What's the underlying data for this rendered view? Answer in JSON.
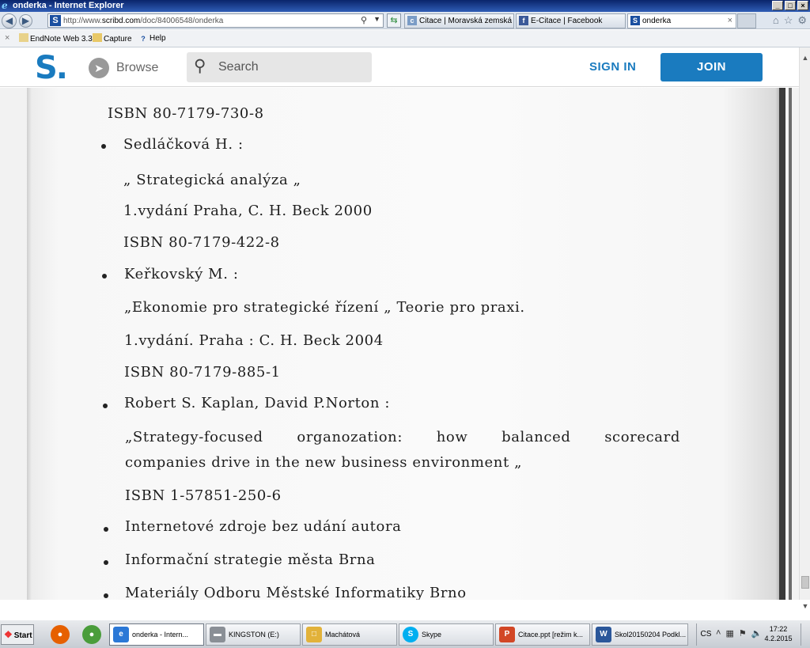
{
  "window": {
    "title": "onderka - Internet Explorer",
    "buttons": [
      "_",
      "□",
      "×"
    ]
  },
  "address": {
    "url_prefix": "http://www.",
    "url_domain": "scribd.com",
    "url_path": "/doc/84006548/onderka"
  },
  "tabs": [
    {
      "label": "Citace | Moravská zemská ...",
      "icon": "citace-icon",
      "color": "#7a9cc6"
    },
    {
      "label": "E-Citace | Facebook",
      "icon": "facebook-icon",
      "color": "#3b5998"
    },
    {
      "label": "onderka",
      "icon": "scribd-icon",
      "color": "#1a4fa0"
    }
  ],
  "favorites": [
    {
      "label": "EndNote Web 3.3"
    },
    {
      "label": "Capture"
    },
    {
      "label": "Help"
    }
  ],
  "scribd": {
    "logo": "S.",
    "browse": "Browse",
    "search_placeholder": "Search",
    "sign_in": "SIGN IN",
    "join": "JOIN",
    "brand_color": "#1a7bbf"
  },
  "document": {
    "lines": [
      "ISBN 80-7179-730-8",
      "Sedláčková H. :",
      "„ Strategická analýza „",
      "1.vydání Praha, C. H. Beck 2000",
      "ISBN 80-7179-422-8",
      "Keřkovský M. :",
      "„Ekonomie pro strategické řízení „ Teorie pro praxi.",
      "1.vydání. Praha : C. H. Beck 2004",
      "ISBN 80-7179-885-1",
      "Robert S. Kaplan, David P.Norton :",
      [
        "„Strategy-focused",
        "organozation:",
        "how",
        "balanced",
        "scorecard"
      ],
      "companies drive in the new business environment „",
      "ISBN 1-57851-250-6",
      "Internetové zdroje bez udání autora",
      "Informační strategie města Brna",
      "Materiály Odboru Městské Informatiky Brno"
    ]
  },
  "taskbar": {
    "start": "Start",
    "buttons": [
      {
        "label": "onderka - Intern...",
        "icon": "internet-explorer-icon",
        "color": "#2b78d6"
      },
      {
        "label": "KINGSTON (E:)",
        "icon": "drive-icon",
        "color": "#8a8f96"
      },
      {
        "label": "Machátová",
        "icon": "folder-icon",
        "color": "#e2b23a"
      },
      {
        "label": "Skype",
        "icon": "skype-icon",
        "color": "#00aff0"
      },
      {
        "label": "Citace.ppt [režim k...",
        "icon": "powerpoint-icon",
        "color": "#d24726"
      },
      {
        "label": "Skol20150204 Podkl...",
        "icon": "word-icon",
        "color": "#2b579a"
      }
    ],
    "lang": "CS",
    "time": "17:22",
    "date": "4.2.2015"
  }
}
